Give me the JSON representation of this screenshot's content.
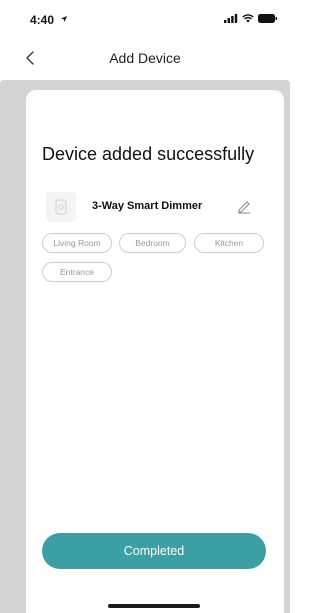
{
  "status_bar": {
    "time": "4:40",
    "icons": [
      "location-arrow-icon",
      "signal-icon",
      "wifi-icon",
      "battery-icon"
    ]
  },
  "nav": {
    "back_icon": "chevron-left-icon",
    "title": "Add Device"
  },
  "main": {
    "headline": "Device added successfully",
    "device": {
      "icon": "device-thumbnail-icon",
      "name": "3-Way Smart Dimmer",
      "edit_icon": "pencil-icon"
    },
    "rooms": [
      "Living Room",
      "Bedroom",
      "Kitchen",
      "Entrance"
    ],
    "primary_button": "Completed"
  },
  "colors": {
    "accent": "#3c9fa3",
    "backdrop": "#d4d4d4",
    "card": "#ffffff",
    "chip_border": "#cfcfcf",
    "chip_text": "#9a9a9a"
  }
}
